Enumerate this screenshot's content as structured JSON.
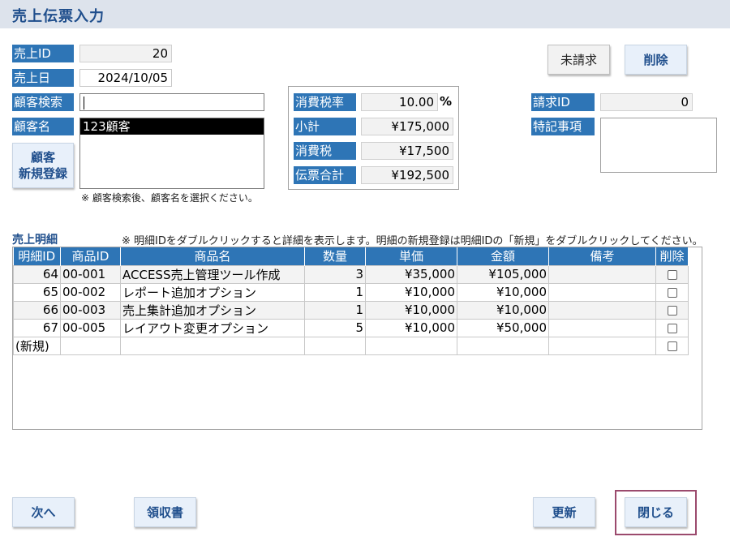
{
  "header": {
    "title": "売上伝票入力"
  },
  "sale": {
    "id_label": "売上ID",
    "id_value": "20",
    "date_label": "売上日",
    "date_value": "2024/10/05"
  },
  "customer": {
    "search_label": "顧客検索",
    "search_value": "",
    "name_label": "顧客名",
    "selected_name": "123顧客",
    "register_button_line1": "顧客",
    "register_button_line2": "新規登録",
    "note": "※ 顧客検索後、顧客名を選択ください。"
  },
  "summary": {
    "tax_rate_label": "消費税率",
    "tax_rate_value": "10.00",
    "tax_rate_unit": "%",
    "subtotal_label": "小計",
    "subtotal_value": "¥175,000",
    "tax_label": "消費税",
    "tax_value": "¥17,500",
    "total_label": "伝票合計",
    "total_value": "¥192,500"
  },
  "billing": {
    "unbilled_button": "未請求",
    "delete_button": "削除",
    "invoice_id_label": "請求ID",
    "invoice_id_value": "0",
    "remarks_label": "特記事項",
    "remarks_value": ""
  },
  "details": {
    "title": "売上明細",
    "note": "※ 明細IDをダブルクリックすると詳細を表示します。明細の新規登録は明細IDの「新規」をダブルクリックしてください。",
    "columns": [
      "明細ID",
      "商品ID",
      "商品名",
      "数量",
      "単価",
      "金額",
      "備考",
      "削除"
    ],
    "rows": [
      {
        "id": "64",
        "product_id": "00-001",
        "product_name": "ACCESS売上管理ツール作成",
        "qty": "3",
        "unit_price": "¥35,000",
        "amount": "¥105,000",
        "note": ""
      },
      {
        "id": "65",
        "product_id": "00-002",
        "product_name": "レポート追加オプション",
        "qty": "1",
        "unit_price": "¥10,000",
        "amount": "¥10,000",
        "note": ""
      },
      {
        "id": "66",
        "product_id": "00-003",
        "product_name": "売上集計追加オプション",
        "qty": "1",
        "unit_price": "¥10,000",
        "amount": "¥10,000",
        "note": ""
      },
      {
        "id": "67",
        "product_id": "00-005",
        "product_name": "レイアウト変更オプション",
        "qty": "5",
        "unit_price": "¥10,000",
        "amount": "¥50,000",
        "note": ""
      }
    ],
    "new_row_label": "(新規)"
  },
  "footer": {
    "next_button": "次へ",
    "receipt_button": "領収書",
    "update_button": "更新",
    "close_button": "閉じる"
  }
}
